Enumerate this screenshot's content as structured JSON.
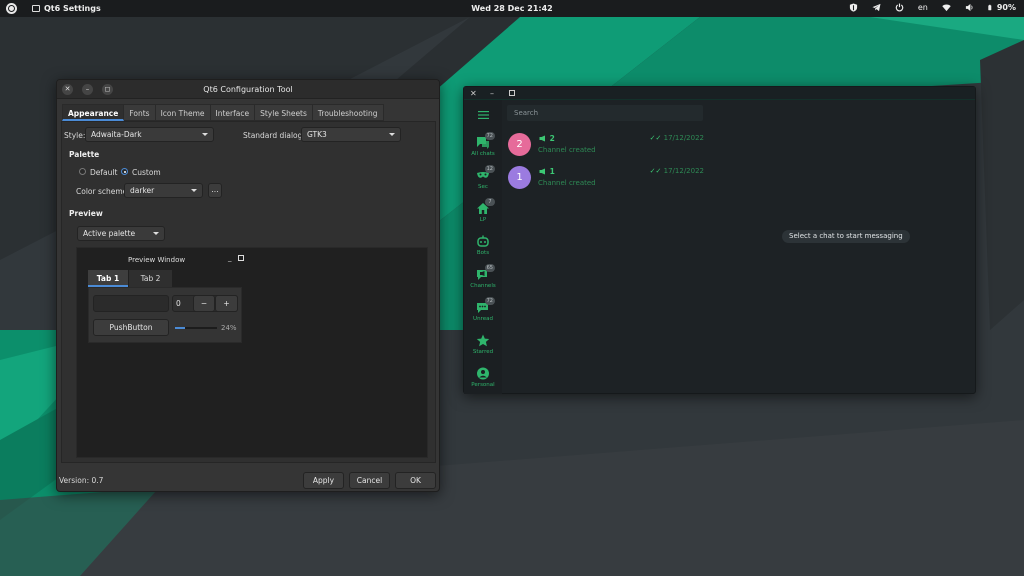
{
  "topbar": {
    "app_name": "Qt6 Settings",
    "clock": "Wed 28 Dec  21:42",
    "language": "en",
    "battery": "90%"
  },
  "qt": {
    "title": "Qt6 Configuration Tool",
    "tabs": [
      "Appearance",
      "Fonts",
      "Icon Theme",
      "Interface",
      "Style Sheets",
      "Troubleshooting"
    ],
    "style_label": "Style:",
    "style_value": "Adwaita-Dark",
    "dialogs_label": "Standard dialogs:",
    "dialogs_value": "GTK3",
    "palette_heading": "Palette",
    "radio_default": "Default",
    "radio_custom": "Custom",
    "color_scheme_label": "Color scheme:",
    "color_scheme_value": "darker",
    "ellipsis": "...",
    "preview_heading": "Preview",
    "palette_select": "Active palette",
    "preview_window_title": "Preview Window",
    "preview_tab1": "Tab 1",
    "preview_tab2": "Tab 2",
    "spin_value": "0",
    "spin_minus": "−",
    "spin_plus": "+",
    "push_button": "PushButton",
    "progress_label": "24%",
    "progress_value": 24,
    "version": "Version: 0.7",
    "apply": "Apply",
    "cancel": "Cancel",
    "ok": "OK"
  },
  "tg": {
    "search_placeholder": "Search",
    "folders": [
      {
        "name": "All chats",
        "badge": "72",
        "icon": "chat-bubbles-icon"
      },
      {
        "name": "Sec",
        "badge": "12",
        "icon": "mask-icon"
      },
      {
        "name": "LP",
        "badge": "7",
        "icon": "house-icon"
      },
      {
        "name": "Bots",
        "badge": "",
        "icon": "bot-icon"
      },
      {
        "name": "Channels",
        "badge": "65",
        "icon": "megaphone-icon"
      },
      {
        "name": "Unread",
        "badge": "72",
        "icon": "chat-unread-icon"
      },
      {
        "name": "Starred",
        "badge": "",
        "icon": "star-icon"
      },
      {
        "name": "Personal",
        "badge": "",
        "icon": "person-icon"
      }
    ],
    "chats": [
      {
        "avatar": "2",
        "name": "2",
        "message": "Channel created",
        "date": "17/12/2022",
        "color": "#e66b9a"
      },
      {
        "avatar": "1",
        "name": "1",
        "message": "Channel created",
        "date": "17/12/2022",
        "color": "#9b7be0"
      }
    ],
    "empty_hint": "Select a chat to start messaging"
  }
}
